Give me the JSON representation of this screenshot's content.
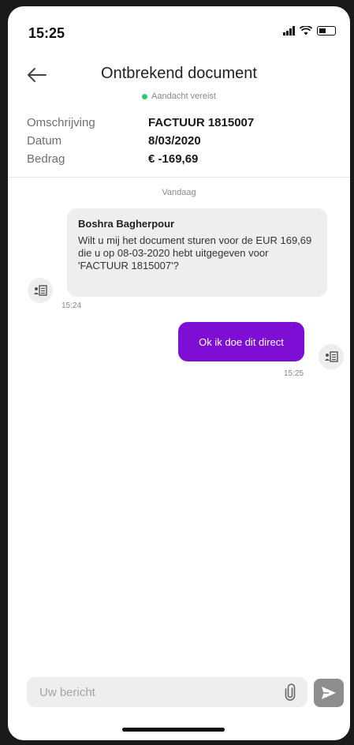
{
  "status_bar": {
    "time": "15:25"
  },
  "header": {
    "title": "Ontbrekend document",
    "status": "Aandacht vereist",
    "status_color": "#2ecc71",
    "back_icon": "arrow-left-icon"
  },
  "details": [
    {
      "label": "Omschrijving",
      "value": "FACTUUR 1815007"
    },
    {
      "label": "Datum",
      "value": "8/03/2020"
    },
    {
      "label": "Bedrag",
      "value": "€ -169,69"
    }
  ],
  "chat": {
    "day_label": "Vandaag",
    "incoming": {
      "sender": "Boshra Bagherpour",
      "text": "Wilt u mij het document sturen voor de EUR 169,69 die u op 08-03-2020 hebt uitgegeven voor 'FACTUUR 1815007'?",
      "time": "15:24"
    },
    "outgoing": {
      "text": "Ok ik doe dit direct",
      "time": "15:25",
      "bubble_color": "#7e0ed4"
    }
  },
  "composer": {
    "placeholder": "Uw bericht",
    "attach_icon": "paperclip-icon",
    "send_icon": "send-icon"
  }
}
